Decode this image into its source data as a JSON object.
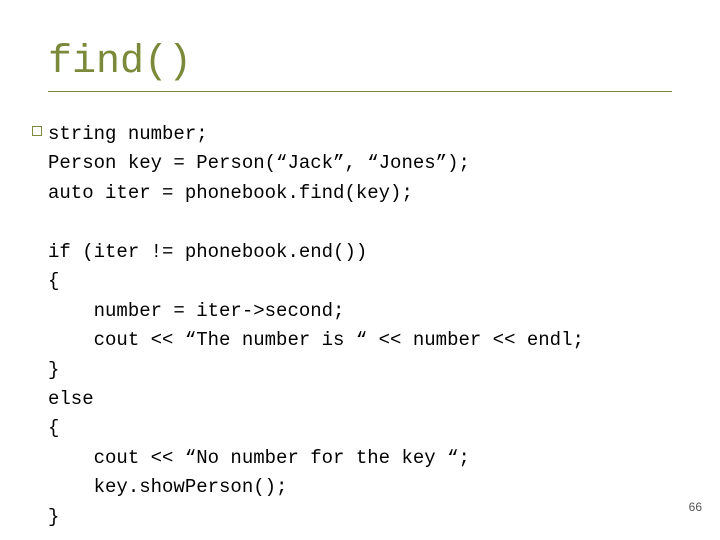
{
  "title": "find()",
  "code": {
    "l1": "string number;",
    "l2": "Person key = Person(“Jack”, “Jones”);",
    "l3": "auto iter = phonebook.find(key);",
    "l4": "",
    "l5": "if (iter != phonebook.end())",
    "l6": "{",
    "l7": "    number = iter->second;",
    "l8": "    cout << “The number is “ << number << endl;",
    "l9": "}",
    "l10": "else",
    "l11": "{",
    "l12": "    cout << “No number for the key “;",
    "l13": "    key.showPerson();",
    "l14": "}"
  },
  "page_number": "66"
}
